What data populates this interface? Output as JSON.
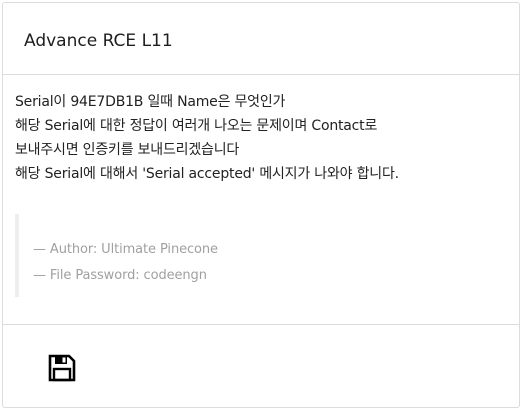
{
  "card": {
    "title": "Advance RCE L11",
    "description_lines": [
      "Serial이 94E7DB1B 일때 Name은 무엇인가",
      "해당 Serial에 대한 정답이 여러개 나오는 문제이며 Contact로",
      "보내주시면 인증키를 보내드리겠습니다",
      "해당 Serial에 대해서 'Serial accepted' 메시지가 나와야 합니다."
    ],
    "author": "— Author: Ultimate Pinecone",
    "file_password": "— File Password: codeengn"
  },
  "footer": {
    "save_icon": "floppy-disk-icon"
  }
}
